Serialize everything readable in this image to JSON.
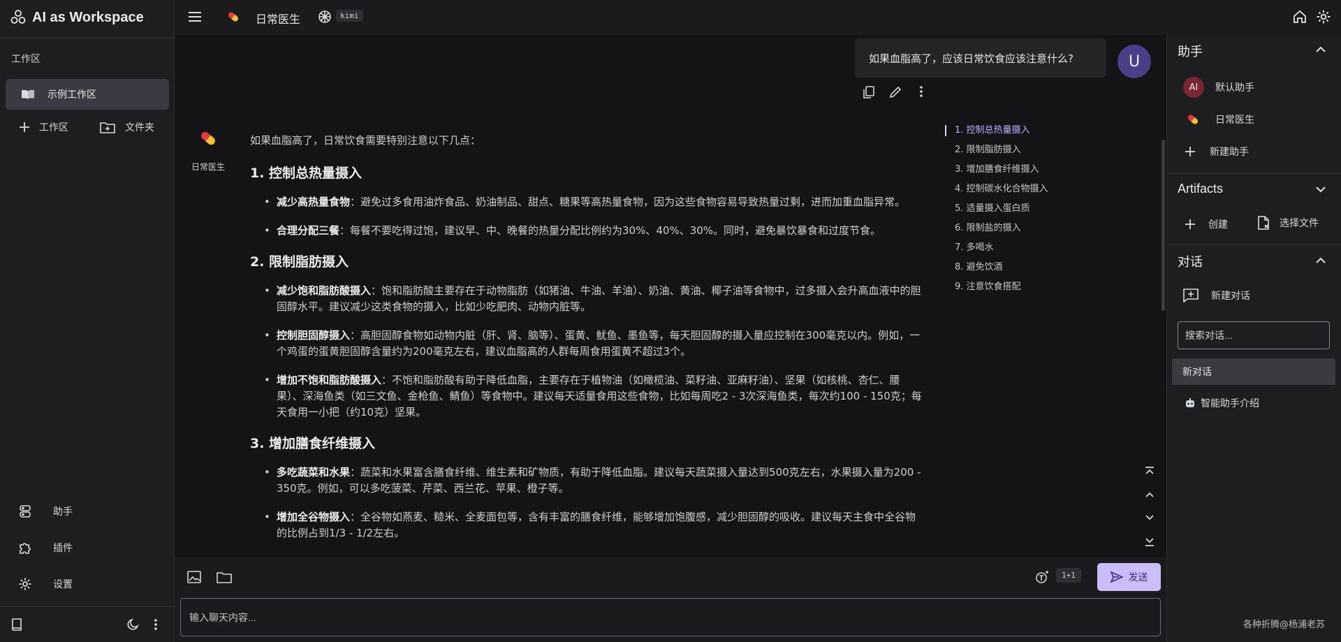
{
  "app": {
    "title": "AI as Workspace",
    "model_tag": "kimi",
    "assistant_name": "日常医生"
  },
  "left_sidebar": {
    "section_label": "工作区",
    "workspace_item": "示例工作区",
    "add_workspace": "工作区",
    "add_folder": "文件夹",
    "nav": [
      "助手",
      "插件",
      "设置"
    ]
  },
  "chat": {
    "user_message": "如果血脂高了，应该日常饮食应该注意什么?",
    "user_avatar": "U",
    "assistant_label": "日常医生",
    "intro": "如果血脂高了，日常饮食需要特别注意以下几点：",
    "sections": [
      {
        "heading": "1. 控制总热量摄入",
        "items": [
          {
            "bold": "减少高热量食物",
            "text": "：避免过多食用油炸食品、奶油制品、甜点、糖果等高热量食物，因为这些食物容易导致热量过剩，进而加重血脂异常。"
          },
          {
            "bold": "合理分配三餐",
            "text": "：每餐不要吃得过饱，建议早、中、晚餐的热量分配比例约为30%、40%、30%。同时，避免暴饮暴食和过度节食。"
          }
        ]
      },
      {
        "heading": "2. 限制脂肪摄入",
        "items": [
          {
            "bold": "减少饱和脂肪酸摄入",
            "text": "：饱和脂肪酸主要存在于动物脂肪（如猪油、牛油、羊油）、奶油、黄油、椰子油等食物中，过多摄入会升高血液中的胆固醇水平。建议减少这类食物的摄入，比如少吃肥肉、动物内脏等。"
          },
          {
            "bold": "控制胆固醇摄入",
            "text": "：高胆固醇食物如动物内脏（肝、肾、脑等）、蛋黄、鱿鱼、墨鱼等，每天胆固醇的摄入量应控制在300毫克以内。例如，一个鸡蛋的蛋黄胆固醇含量约为200毫克左右，建议血脂高的人群每周食用蛋黄不超过3个。"
          },
          {
            "bold": "增加不饱和脂肪酸摄入",
            "text": "：不饱和脂肪酸有助于降低血脂，主要存在于植物油（如橄榄油、菜籽油、亚麻籽油）、坚果（如核桃、杏仁、腰果）、深海鱼类（如三文鱼、金枪鱼、鲭鱼）等食物中。建议每天适量食用这些食物，比如每周吃2 - 3次深海鱼类，每次约100 - 150克；每天食用一小把（约10克）坚果。"
          }
        ]
      },
      {
        "heading": "3. 增加膳食纤维摄入",
        "items": [
          {
            "bold": "多吃蔬菜和水果",
            "text": "：蔬菜和水果富含膳食纤维、维生素和矿物质，有助于降低血脂。建议每天蔬菜摄入量达到500克左右，水果摄入量为200 - 350克。例如，可以多吃菠菜、芹菜、西兰花、苹果、橙子等。"
          },
          {
            "bold": "增加全谷物摄入",
            "text": "：全谷物如燕麦、糙米、全麦面包等，含有丰富的膳食纤维，能够增加饱腹感，减少胆固醇的吸收。建议每天主食中全谷物的比例占到1/3 - 1/2左右。"
          }
        ]
      }
    ],
    "toc": [
      "1. 控制总热量摄入",
      "2. 限制脂肪摄入",
      "3. 增加膳食纤维摄入",
      "4. 控制碳水化合物摄入",
      "5. 适量摄入蛋白质",
      "6. 限制盐的摄入",
      "7. 多喝水",
      "8. 避免饮酒",
      "9. 注意饮食搭配"
    ]
  },
  "composer": {
    "placeholder": "输入聊天内容...",
    "count": "1+1",
    "send_label": "发送"
  },
  "right_panel": {
    "assistants_title": "助手",
    "assistants": [
      {
        "avatar": "AI",
        "name": "默认助手"
      },
      {
        "avatar": "pill",
        "name": "日常医生"
      }
    ],
    "new_assistant": "新建助手",
    "artifacts_title": "Artifacts",
    "create": "创建",
    "choose_file": "选择文件",
    "conversations_title": "对话",
    "new_conversation": "新建对话",
    "search_placeholder": "搜索对话...",
    "conversations": [
      "新对话",
      "智能助手介绍"
    ]
  },
  "footer": "各种折腾@杨浦老苏"
}
